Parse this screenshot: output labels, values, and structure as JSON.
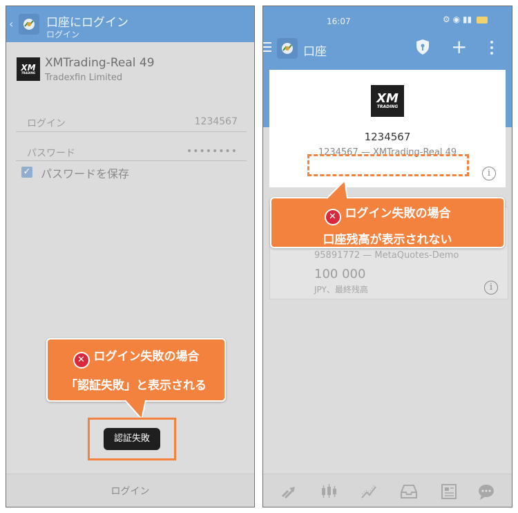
{
  "login_screen": {
    "header": {
      "back_glyph": "‹",
      "title": "口座にログイン",
      "subtitle": "ログイン"
    },
    "server": {
      "logo_text": "XM",
      "logo_subtext": "TRADING",
      "name": "XMTrading-Real 49",
      "company": "Tradexfin Limited"
    },
    "login_field": {
      "label": "ログイン",
      "value": "1234567"
    },
    "password_field": {
      "label": "パスワード",
      "value": "••••••••"
    },
    "save_password": {
      "label": "パスワードを保存",
      "checked": true
    },
    "callout": {
      "line1": "ログイン失敗の場合",
      "line2": "「認証失敗」と表示される",
      "icon": "error-icon"
    },
    "toast": "認証失敗",
    "login_button": "ログイン"
  },
  "accounts_screen": {
    "status_bar": {
      "time": "16:07"
    },
    "header": {
      "title": "口座",
      "icons": [
        "menu-icon",
        "shield-icon",
        "plus-icon",
        "more-icon"
      ]
    },
    "current_account": {
      "logo_text": "XM",
      "logo_subtext": "TRADING",
      "number": "1234567",
      "server_line": "1234567 — XMTrading-Real 49"
    },
    "callout": {
      "line1": "ログイン失敗の場合",
      "line2": "口座残高が表示されない",
      "icon": "error-icon"
    },
    "other_account": {
      "server_line": "95891772 — MetaQuotes-Demo",
      "balance": "100 000",
      "caption": "JPY、最終残高"
    },
    "bottom_nav": [
      "quotes-icon",
      "chart-icon",
      "trade-icon",
      "history-icon",
      "news-icon",
      "chat-icon"
    ]
  },
  "colors": {
    "header_blue": "#6a9fd6",
    "callout_orange": "#f4823f",
    "error_red": "#d7283c",
    "overlay_gray": "#dcdcdc"
  }
}
